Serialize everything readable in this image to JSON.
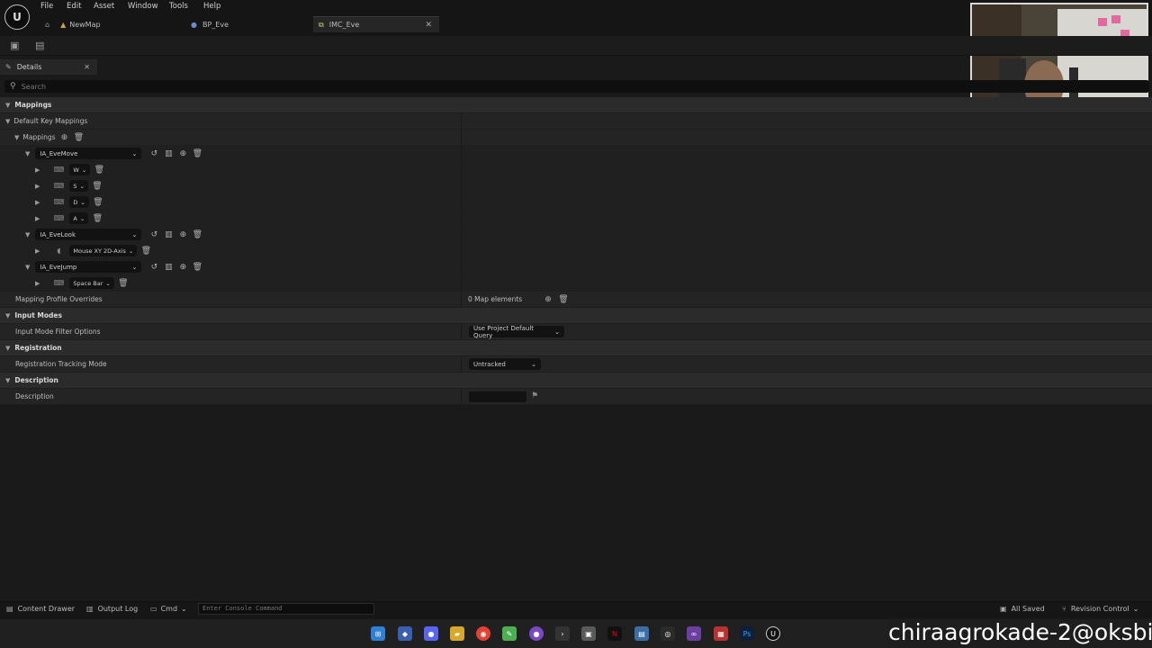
{
  "menu": [
    "File",
    "Edit",
    "Asset",
    "Window",
    "Tools",
    "Help"
  ],
  "tabs": [
    {
      "label": "NewMap"
    },
    {
      "label": "BP_Eve"
    },
    {
      "label": "IMC_Eve"
    }
  ],
  "details": {
    "tab_label": "Details",
    "search_placeholder": "Search"
  },
  "sections": {
    "mappings": "Mappings",
    "default_key_mappings": "Default Key Mappings",
    "mappings_array": "Mappings",
    "mapping_profile_overrides": "Mapping Profile Overrides",
    "map_elements": "0 Map elements",
    "input_modes": "Input Modes",
    "input_mode_filter_options": "Input Mode Filter Options",
    "input_mode_filter_value": "Use Project Default Query",
    "registration": "Registration",
    "registration_tracking_mode": "Registration Tracking Mode",
    "registration_tracking_value": "Untracked",
    "description": "Description",
    "description_label": "Description"
  },
  "actions": [
    {
      "name": "IA_EveMove",
      "keys": [
        "W",
        "S",
        "D",
        "A"
      ]
    },
    {
      "name": "IA_EveLook",
      "keys": [
        "Mouse XY 2D-Axis"
      ]
    },
    {
      "name": "IA_EveJump",
      "keys": [
        "Space Bar"
      ]
    }
  ],
  "statusbar": {
    "content_drawer": "Content Drawer",
    "output_log": "Output Log",
    "cmd": "Cmd",
    "console_placeholder": "Enter Console Command",
    "all_saved": "All Saved",
    "revision_control": "Revision Control"
  },
  "watermark": "chiraagrokade-2@oksbi",
  "colors": {
    "accent_taskbar_blue": "#2f7fd6",
    "background": "#1a1a1a"
  }
}
